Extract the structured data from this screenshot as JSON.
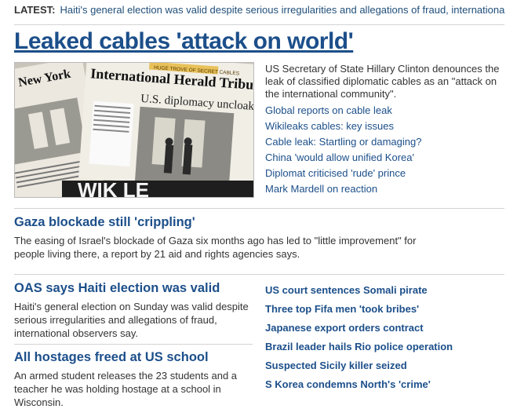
{
  "latest": {
    "label": "LATEST:",
    "text": "Haiti's general election was valid despite serious irregularities and allegations of fraud, internationa"
  },
  "top_story": {
    "headline": "Leaked cables 'attack on world'",
    "summary": "US Secretary of State Hillary Clinton denounces the leak of classified diplomatic cables as an \"attack on the international community\".",
    "image": {
      "masthead": "International Herald Tribune",
      "masthead_left": "New York",
      "banner": "HUGE TROVE OF SECRET CABLES",
      "headline": "U.S. diplomacy uncloaked",
      "bottom_text": "WIK  LE"
    },
    "links": [
      "Global reports on cable leak",
      "Wikileaks cables: key issues",
      "Cable leak: Startling or damaging?",
      "China 'would allow unified Korea'",
      "Diplomat criticised 'rude' prince",
      "Mark Mardell on reaction"
    ]
  },
  "stories": [
    {
      "headline": "Gaza blockade still 'crippling'",
      "summary": "The easing of Israel's blockade of Gaza six months ago has led to \"little improvement\" for people living there, a report by 21 aid and rights agencies says."
    },
    {
      "headline": "OAS says Haiti election was valid",
      "summary": "Haiti's general election on Sunday was valid despite serious irregularities and allegations of fraud, international observers say."
    },
    {
      "headline": "All hostages freed at US school",
      "summary": "An armed student releases the 23 students and a teacher he was holding hostage at a school in Wisconsin."
    }
  ],
  "side_links": [
    "US court sentences Somali pirate",
    "Three top Fifa men 'took bribes'",
    "Japanese export orders contract",
    "Brazil leader hails Rio police operation",
    "Suspected Sicily killer seized",
    "S Korea condemns North's 'crime'"
  ]
}
